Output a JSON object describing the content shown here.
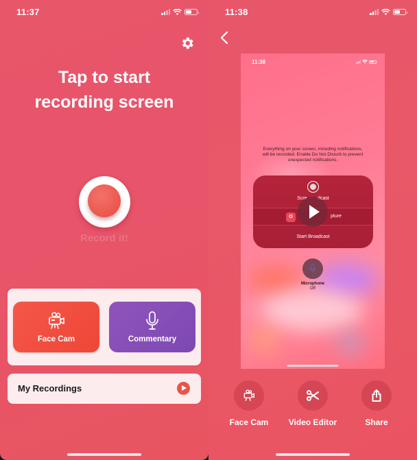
{
  "left_screen": {
    "status": {
      "time": "11:37"
    },
    "settings_icon": "gear-icon",
    "headline": [
      "Tap to start",
      "recording screen"
    ],
    "record_button": {
      "label": "Record it!"
    },
    "tools": [
      {
        "label": "Face Cam",
        "icon": "video-camera-icon",
        "color": "#f04a3d"
      },
      {
        "label": "Commentary",
        "icon": "microphone-icon",
        "color": "#8650b8"
      }
    ],
    "my_recordings": {
      "label": "My Recordings",
      "icon": "play-circle-icon"
    }
  },
  "right_screen": {
    "status": {
      "time": "11:38"
    },
    "back_icon": "chevron-left-icon",
    "preview": {
      "status_time": "11:38",
      "notice": "Everything on your screen, including notifications, will be recorded. Enable Do Not Disturb to prevent unexpected notifications.",
      "panel_title": "Screen Broadcast",
      "panel_title_visible": "Scre        dcast",
      "app_icon_text": "O",
      "app_name_visible": "pture",
      "start_label": "Start Broadcast",
      "microphone_label": "Microphone",
      "microphone_state": "Off"
    },
    "actions": [
      {
        "label": "Face Cam",
        "icon": "video-camera-icon"
      },
      {
        "label": "Video Editor",
        "icon": "scissors-icon"
      },
      {
        "label": "Share",
        "icon": "share-icon"
      }
    ]
  },
  "colors": {
    "background": "#e8566a",
    "record_red": "#ec5a50",
    "card_bg": "#fcecee",
    "facecam": "#f04a3d",
    "commentary": "#8650b8"
  }
}
